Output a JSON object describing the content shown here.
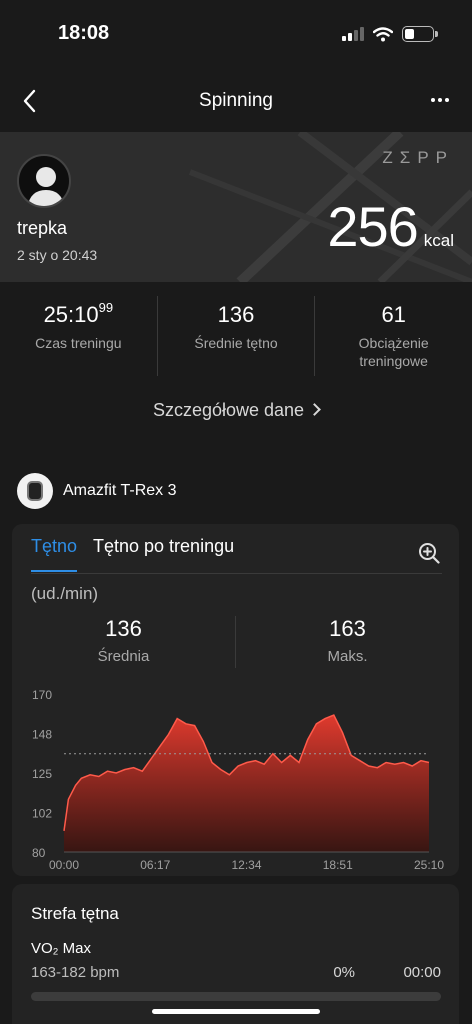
{
  "status_bar": {
    "time": "18:08",
    "battery_level": 0.35
  },
  "nav": {
    "title": "Spinning",
    "back_icon": "chevron-left-icon",
    "more_icon": "more-icon"
  },
  "hero": {
    "brand": "ZΣPP",
    "user_name": "trepka",
    "date": "2 sty o 20:43",
    "kcal_value": "256",
    "kcal_unit": "kcal"
  },
  "stats": [
    {
      "value": "25:10",
      "value_sup": "99",
      "label": "Czas treningu"
    },
    {
      "value": "136",
      "value_sup": "",
      "label": "Średnie tętno"
    },
    {
      "value": "61",
      "value_sup": "",
      "label": "Obciążenie treningowe"
    }
  ],
  "details_link": "Szczegółowe dane",
  "device": {
    "name": "Amazfit T-Rex 3"
  },
  "chart_card": {
    "tabs": [
      "Tętno",
      "Tętno po treningu"
    ],
    "unit": "(ud./min)",
    "avg_value": "136",
    "avg_label": "Średnia",
    "max_value": "163",
    "max_label": "Maks."
  },
  "chart_data": {
    "type": "area",
    "ylim": [
      80,
      170
    ],
    "yticks": [
      "170",
      "148",
      "125",
      "102",
      "80"
    ],
    "xticks": [
      "00:00",
      "06:17",
      "12:34",
      "18:51",
      "25:10"
    ],
    "reference_line": 136,
    "color": "#e03a2e",
    "x": [
      0,
      0.3,
      0.8,
      1.2,
      1.8,
      2.4,
      3.0,
      3.6,
      4.2,
      4.8,
      5.4,
      6.0,
      6.6,
      7.2,
      7.8,
      8.4,
      9.0,
      9.6,
      10.2,
      10.8,
      11.4,
      12.0,
      12.6,
      13.2,
      13.8,
      14.4,
      15.0,
      15.6,
      16.2,
      16.8,
      17.4,
      18.0,
      18.6,
      19.2,
      19.8,
      20.4,
      21.0,
      21.6,
      22.2,
      22.8,
      23.4,
      24.0,
      24.6,
      25.16
    ],
    "values": [
      92,
      110,
      118,
      122,
      124,
      123,
      126,
      125,
      127,
      128,
      126,
      133,
      140,
      147,
      156,
      153,
      152,
      143,
      131,
      127,
      124,
      129,
      131,
      132,
      130,
      136,
      131,
      135,
      131,
      144,
      153,
      156,
      158,
      148,
      135,
      132,
      129,
      128,
      131,
      130,
      131,
      129,
      132,
      131
    ]
  },
  "zone_card": {
    "title": "Strefa tętna",
    "zone_name": "VO₂ Max",
    "range": "163-182 bpm",
    "percent": "0%",
    "time": "00:00",
    "fill_fraction": 0
  },
  "colors": {
    "accent": "#2e8ee6",
    "chart": "#e03a2e",
    "background": "#1a1a1a",
    "card": "#232323"
  }
}
